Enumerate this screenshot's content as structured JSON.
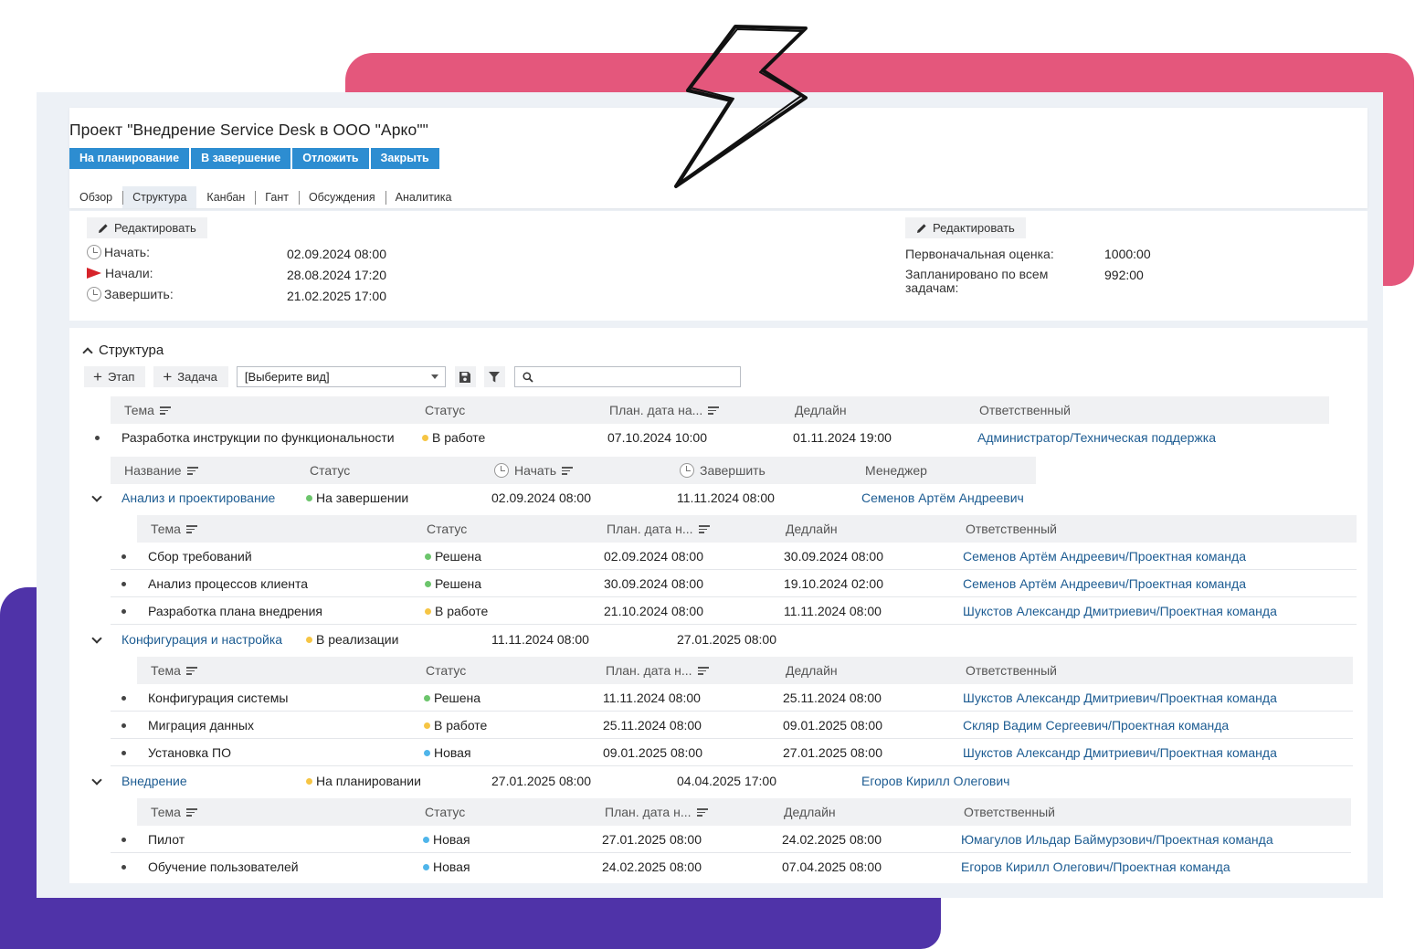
{
  "colors": {
    "accent": "#2d8dd1",
    "link": "#1d5c92",
    "pink_decor": "#e4577c",
    "purple_decor": "#4f33a8",
    "status_done": "#6cc56c",
    "status_work": "#f6c544",
    "status_new": "#4fb5ea"
  },
  "project": {
    "title": "Проект \"Внедрение Service Desk в ООО \"Арко\"\""
  },
  "actions": [
    "На планирование",
    "В завершение",
    "Отложить",
    "Закрыть"
  ],
  "tabs": [
    "Обзор",
    "Структура",
    "Канбан",
    "Гант",
    "Обсуждения",
    "Аналитика"
  ],
  "active_tab": "Структура",
  "info": {
    "edit_label": "Редактировать",
    "left": [
      {
        "icon": "clock-icon",
        "label": "Начать:",
        "value": "02.09.2024 08:00"
      },
      {
        "icon": "flag-icon",
        "label": "Начали:",
        "value": "28.08.2024 17:20"
      },
      {
        "icon": "clock-icon",
        "label": "Завершить:",
        "value": "21.02.2025 17:00"
      }
    ],
    "right": [
      {
        "label": "Первоначальная оценка:",
        "value": "1000:00"
      },
      {
        "label": "Запланировано по всем задачам:",
        "value": "992:00"
      }
    ]
  },
  "structure": {
    "heading": "Структура",
    "add_stage": "Этап",
    "add_task": "Задача",
    "view_select": "[Выберите вид]",
    "search_placeholder": "",
    "task_columns": [
      "Тема",
      "Статус",
      "План. дата на...",
      "Дедлайн",
      "Ответственный"
    ],
    "sub_task_columns": [
      "Тема",
      "Статус",
      "План. дата н...",
      "Дедлайн",
      "Ответственный"
    ],
    "stage_columns": [
      "Название",
      "Статус",
      "Начать",
      "Завершить",
      "Менеджер"
    ],
    "top_task": {
      "topic": "Разработка инструкции по функциональности",
      "status": "В работе",
      "status_color": "#f6c544",
      "plan": "07.10.2024 10:00",
      "deadline": "01.11.2024 19:00",
      "owner": "Администратор/Техническая поддержка"
    },
    "stages": [
      {
        "name": "Анализ и проектирование",
        "status": "На завершении",
        "status_color": "#6cc56c",
        "start": "02.09.2024 08:00",
        "end": "11.11.2024 08:00",
        "manager": "Семенов Артём Андреевич",
        "tasks": [
          {
            "topic": "Сбор требований",
            "status": "Решена",
            "status_color": "#6cc56c",
            "plan": "02.09.2024 08:00",
            "deadline": "30.09.2024 08:00",
            "owner": "Семенов Артём Андреевич/Проектная команда"
          },
          {
            "topic": "Анализ процессов клиента",
            "status": "Решена",
            "status_color": "#6cc56c",
            "plan": "30.09.2024 08:00",
            "deadline": "19.10.2024 02:00",
            "owner": "Семенов Артём Андреевич/Проектная команда"
          },
          {
            "topic": "Разработка плана внедрения",
            "status": "В работе",
            "status_color": "#f6c544",
            "plan": "21.10.2024 08:00",
            "deadline": "11.11.2024 08:00",
            "owner": "Шукстов Александр Дмитриевич/Проектная команда"
          }
        ]
      },
      {
        "name": "Конфигурация и настройка",
        "status": "В реализации",
        "status_color": "#f6c544",
        "start": "11.11.2024 08:00",
        "end": "27.01.2025 08:00",
        "manager": "",
        "tasks": [
          {
            "topic": "Конфигурация системы",
            "status": "Решена",
            "status_color": "#6cc56c",
            "plan": "11.11.2024 08:00",
            "deadline": "25.11.2024 08:00",
            "owner": "Шукстов Александр Дмитриевич/Проектная команда"
          },
          {
            "topic": "Миграция данных",
            "status": "В работе",
            "status_color": "#f6c544",
            "plan": "25.11.2024 08:00",
            "deadline": "09.01.2025 08:00",
            "owner": "Скляр Вадим Сергеевич/Проектная команда"
          },
          {
            "topic": "Установка ПО",
            "status": "Новая",
            "status_color": "#4fb5ea",
            "plan": "09.01.2025 08:00",
            "deadline": "27.01.2025 08:00",
            "owner": "Шукстов Александр Дмитриевич/Проектная команда"
          }
        ]
      },
      {
        "name": "Внедрение",
        "status": "На планировании",
        "status_color": "#f6c544",
        "start": "27.01.2025 08:00",
        "end": "04.04.2025 17:00",
        "manager": "Егоров Кирилл Олегович",
        "tasks": [
          {
            "topic": "Пилот",
            "status": "Новая",
            "status_color": "#4fb5ea",
            "plan": "27.01.2025 08:00",
            "deadline": "24.02.2025 08:00",
            "owner": "Юмагулов Ильдар Баймурзович/Проектная команда"
          },
          {
            "topic": "Обучение пользователей",
            "status": "Новая",
            "status_color": "#4fb5ea",
            "plan": "24.02.2025 08:00",
            "deadline": "07.04.2025 08:00",
            "owner": "Егоров Кирилл Олегович/Проектная команда"
          }
        ]
      }
    ]
  }
}
